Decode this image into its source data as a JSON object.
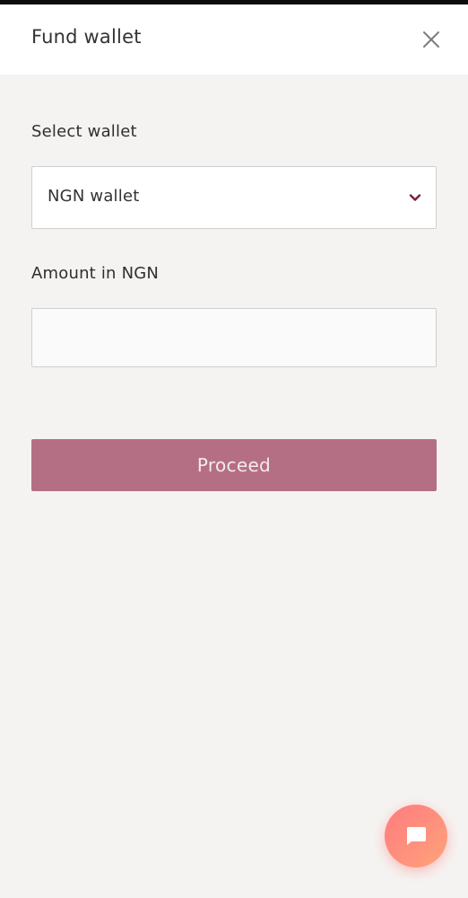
{
  "header": {
    "title": "Fund wallet"
  },
  "form": {
    "wallet_label": "Select wallet",
    "wallet_selected": "NGN wallet",
    "amount_label": "Amount in NGN",
    "amount_value": "",
    "amount_placeholder": ""
  },
  "actions": {
    "proceed_label": "Proceed"
  },
  "icons": {
    "close": "close-icon",
    "dropdown": "chevron-down-icon",
    "chat": "chat-bubble-icon"
  },
  "colors": {
    "accent": "#b56f85",
    "chevron": "#7a1f3d",
    "chat_fab_start": "#fe7b7f",
    "chat_fab_end": "#ffa37a"
  }
}
